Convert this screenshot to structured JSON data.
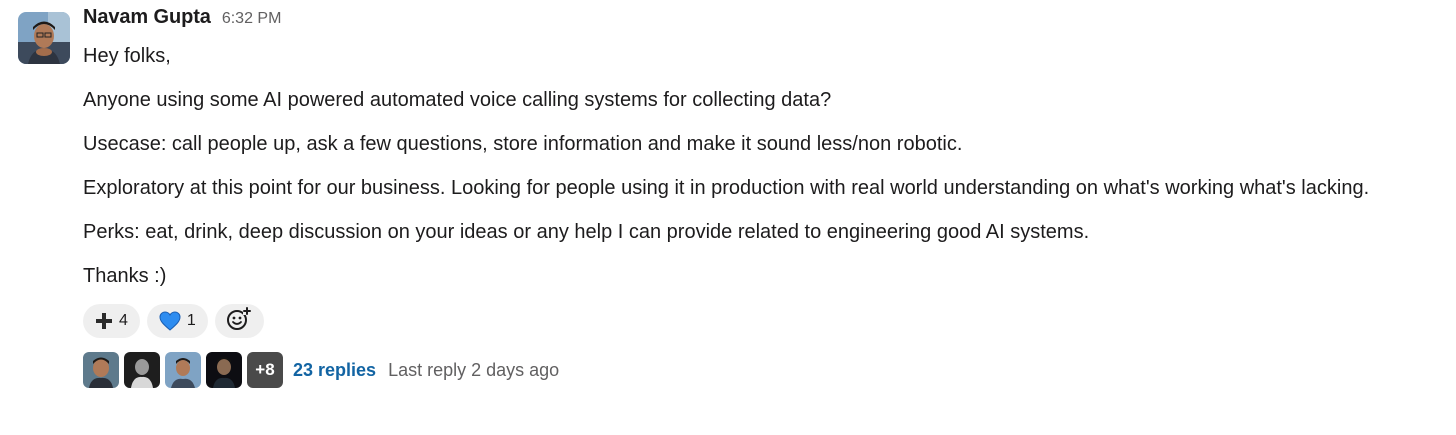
{
  "message": {
    "author": "Navam Gupta",
    "time": "6:32 PM",
    "paragraphs": [
      "Hey folks,",
      "Anyone using some AI powered automated voice calling systems for collecting data?",
      "Usecase: call people up, ask a few questions, store information and make it sound less/non robotic.",
      "Exploratory at this point for our business. Looking for people using it in production with real world understanding on what's working what's lacking.",
      "Perks: eat, drink, deep discussion on your ideas or any help I can provide related to engineering good AI systems.",
      "Thanks :)"
    ]
  },
  "reactions": [
    {
      "icon": "plus-icon",
      "count": "4"
    },
    {
      "icon": "blue-heart-icon",
      "count": "1"
    }
  ],
  "add_reaction_icon": "add-emoji-icon",
  "thread": {
    "more_count": "+8",
    "replies": "23 replies",
    "last_reply": "Last reply 2 days ago"
  },
  "colors": {
    "link": "#1264a3",
    "muted": "#616061",
    "reaction_bg": "#efefef"
  }
}
